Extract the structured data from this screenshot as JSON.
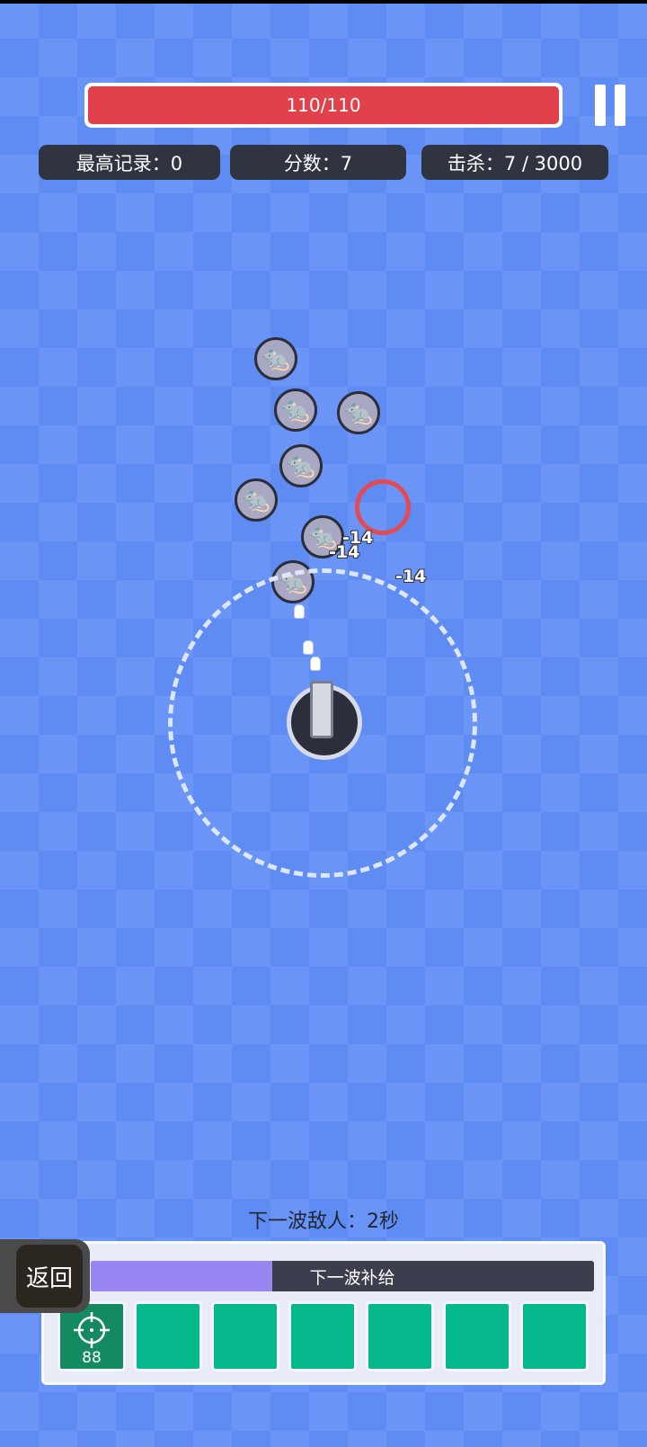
{
  "hud": {
    "hp_text": "110/110",
    "hp_fraction": 1.0,
    "pause_icon": "pause-icon",
    "high_score": "最高记录：0",
    "score": "分数：7",
    "kills": "击杀：7 / 3000"
  },
  "field": {
    "enemy_icon": "rat-icon",
    "damage_numbers": [
      "-14",
      "-14",
      "-14"
    ]
  },
  "wave": {
    "next_wave": "下一波敌人：2秒"
  },
  "supply": {
    "label": "下一波补给",
    "progress": 0.36,
    "slot1_count": "88",
    "slot1_icon": "crosshair-icon"
  },
  "back_button": "返回",
  "colors": {
    "hp": "#e0414a",
    "supply_fill": "#9a86f2",
    "slot": "#06b98c",
    "background": "#6a95f6"
  }
}
